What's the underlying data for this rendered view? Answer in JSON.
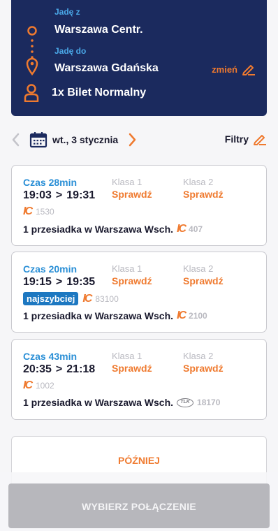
{
  "header": {
    "from_label": "Jadę z",
    "from_station": "Warszawa Centr.",
    "to_label": "Jadę do",
    "to_station": "Warszawa Gdańska",
    "change_label": "zmień",
    "ticket_label": "1x Bilet Normalny"
  },
  "date_bar": {
    "date": "wt., 3 stycznia",
    "filters_label": "Filtry"
  },
  "connections": [
    {
      "duration": "Czas 28min",
      "depart": "19:03",
      "arrive": "19:31",
      "class1_label": "Klasa 1",
      "class1_value": "Sprawdź",
      "class2_label": "Klasa 2",
      "class2_value": "Sprawdź",
      "badge": "",
      "carrier1": "IC",
      "train1": "1530",
      "transfer": "1 przesiadka w Warszawa Wsch.",
      "carrier2": "IC",
      "train2": "407"
    },
    {
      "duration": "Czas 20min",
      "depart": "19:15",
      "arrive": "19:35",
      "class1_label": "Klasa 1",
      "class1_value": "Sprawdź",
      "class2_label": "Klasa 2",
      "class2_value": "Sprawdź",
      "badge": "najszybciej",
      "carrier1": "IC",
      "train1": "83100",
      "transfer": "1 przesiadka w Warszawa Wsch.",
      "carrier2": "IC",
      "train2": "2100"
    },
    {
      "duration": "Czas 43min",
      "depart": "20:35",
      "arrive": "21:18",
      "class1_label": "Klasa 1",
      "class1_value": "Sprawdź",
      "class2_label": "Klasa 2",
      "class2_value": "Sprawdź",
      "badge": "",
      "carrier1": "IC",
      "train1": "1002",
      "transfer": "1 przesiadka w Warszawa Wsch.",
      "carrier2": "TLK",
      "train2": "18170"
    }
  ],
  "later_label": "PÓŹNIEJ",
  "choose_label": "WYBIERZ POŁĄCZENIE",
  "icons": {
    "route": "route-dots-pin-icon",
    "person": "person-icon",
    "edit": "pencil-icon",
    "calendar": "calendar-icon",
    "prev": "chevron-left-icon",
    "next": "chevron-right-icon"
  },
  "colors": {
    "navy": "#1b2a5e",
    "orange": "#ef7a2f",
    "blue": "#2a8fd6",
    "badge_blue": "#1d78c1",
    "disabled_gray": "#b7b7bc"
  }
}
